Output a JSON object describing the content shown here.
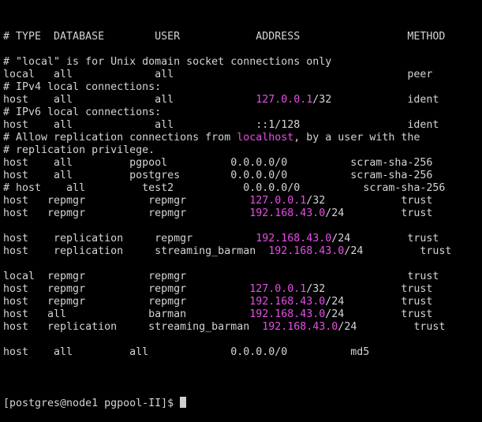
{
  "terminal": {
    "highlight_color": "#e64fe6",
    "text_color": "#d4d4d4",
    "background": "#000000",
    "lines": [
      [
        {
          "t": "# TYPE  DATABASE        USER            ADDRESS                 METHOD"
        }
      ],
      [
        {
          "t": ""
        }
      ],
      [
        {
          "t": "# \"local\" is for Unix domain socket connections only"
        }
      ],
      [
        {
          "t": "local   all             all                                     peer"
        }
      ],
      [
        {
          "t": "# IPv4 local connections:"
        }
      ],
      [
        {
          "t": "host    all             all             "
        },
        {
          "t": "127.0.0.1",
          "hl": true
        },
        {
          "t": "/32            ident"
        }
      ],
      [
        {
          "t": "# IPv6 local connections:"
        }
      ],
      [
        {
          "t": "host    all             all             ::1/128                 ident"
        }
      ],
      [
        {
          "t": "# Allow replication connections from "
        },
        {
          "t": "localhost",
          "hl": true
        },
        {
          "t": ", by a user with the"
        }
      ],
      [
        {
          "t": "# replication privilege."
        }
      ],
      [
        {
          "t": "host    all         pgpool          0.0.0.0/0          scram-sha-256"
        }
      ],
      [
        {
          "t": "host    all         postgres        0.0.0.0/0          scram-sha-256"
        }
      ],
      [
        {
          "t": "# host    all         test2           0.0.0.0/0          scram-sha-256"
        }
      ],
      [
        {
          "t": "host   repmgr          repmgr          "
        },
        {
          "t": "127.0.0.1",
          "hl": true
        },
        {
          "t": "/32            trust"
        }
      ],
      [
        {
          "t": "host   repmgr          repmgr          "
        },
        {
          "t": "192.168.43.0",
          "hl": true
        },
        {
          "t": "/24         trust"
        }
      ],
      [
        {
          "t": ""
        }
      ],
      [
        {
          "t": "host    replication     repmgr          "
        },
        {
          "t": "192.168.43.0",
          "hl": true
        },
        {
          "t": "/24         trust"
        }
      ],
      [
        {
          "t": "host    replication     streaming_barman  "
        },
        {
          "t": "192.168.43.0",
          "hl": true
        },
        {
          "t": "/24         trust"
        }
      ],
      [
        {
          "t": ""
        }
      ],
      [
        {
          "t": "local  repmgr          repmgr                                   trust"
        }
      ],
      [
        {
          "t": "host   repmgr          repmgr          "
        },
        {
          "t": "127.0.0.1",
          "hl": true
        },
        {
          "t": "/32            trust"
        }
      ],
      [
        {
          "t": "host   repmgr          repmgr          "
        },
        {
          "t": "192.168.43.0",
          "hl": true
        },
        {
          "t": "/24         trust"
        }
      ],
      [
        {
          "t": "host   all             barman          "
        },
        {
          "t": "192.168.43.0",
          "hl": true
        },
        {
          "t": "/24         trust"
        }
      ],
      [
        {
          "t": "host   replication     streaming_barman  "
        },
        {
          "t": "192.168.43.0",
          "hl": true
        },
        {
          "t": "/24         trust"
        }
      ],
      [
        {
          "t": ""
        }
      ],
      [
        {
          "t": "host    all         all             0.0.0.0/0          md5"
        }
      ],
      [
        {
          "t": ""
        }
      ]
    ],
    "prompt": "[postgres@node1 pgpool-II]$ "
  }
}
